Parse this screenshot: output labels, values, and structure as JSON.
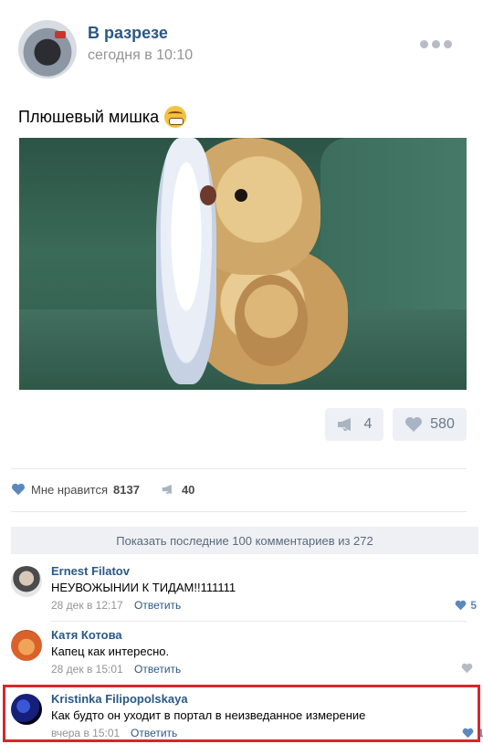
{
  "post": {
    "group_name": "В разрезе",
    "time": "сегодня в 10:10",
    "text": "Плюшевый мишка",
    "emoji_icon": "grimacing-face-emoji",
    "repost_count": "4",
    "like_count": "580"
  },
  "stats": {
    "likes_label": "Мне нравится",
    "likes_count": "8137",
    "reposts_count": "40"
  },
  "comments_header": "Показать последние 100 комментариев из 272",
  "comments": [
    {
      "author": "Ernest Filatov",
      "text": "НЕУВОЖЫНИИ К ТИДАМ!!111111",
      "date": "28 дек в 12:17",
      "reply": "Ответить",
      "likes": "5"
    },
    {
      "author": "Катя Котова",
      "text": "Капец как интересно.",
      "date": "28 дек в 15:01",
      "reply": "Ответить",
      "likes": ""
    },
    {
      "author": "Kristinka Filipopolskaya",
      "text": "Как будто он уходит в портал в неизведанное измерение",
      "date": "вчера в 15:01",
      "reply": "Ответить",
      "likes": "1"
    }
  ],
  "colors": {
    "link": "#2a5885",
    "highlight": "#d8262c",
    "like_blue": "#5b88bd"
  }
}
